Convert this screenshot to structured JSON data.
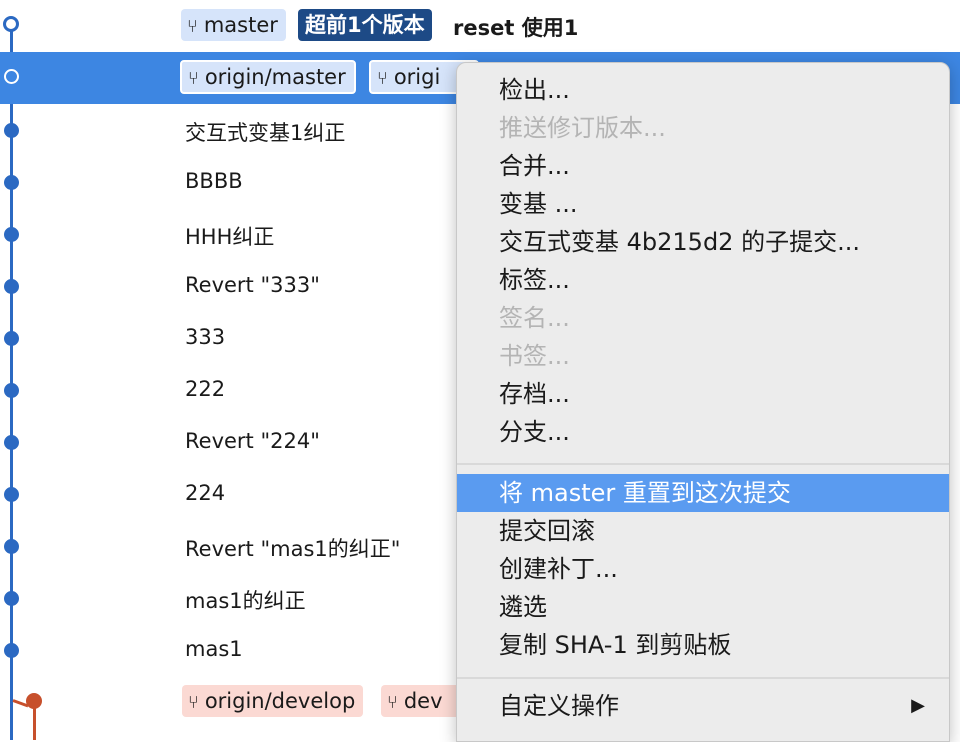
{
  "top_row": {
    "branch_label": "master",
    "ahead_badge": "超前1个版本",
    "commit_message": "reset 使用1"
  },
  "selected_row": {
    "tag1": "origin/master",
    "tag2": "origi"
  },
  "commits": [
    "交互式变基1纠正",
    "BBBB",
    "HHH纠正",
    "Revert \"333\"",
    "333",
    "222",
    "Revert \"224\"",
    "224",
    "Revert \"mas1的纠正\"",
    "mas1的纠正",
    "mas1"
  ],
  "bottom_row": {
    "tag1": "origin/develop",
    "tag2": "dev"
  },
  "branch_icon": "branch-icon",
  "context_menu": {
    "items": [
      {
        "label": "检出...",
        "enabled": true
      },
      {
        "label": "推送修订版本...",
        "enabled": false
      },
      {
        "label": "合并...",
        "enabled": true
      },
      {
        "label": "变基 ...",
        "enabled": true
      },
      {
        "label": "交互式变基 4b215d2 的子提交...",
        "enabled": true
      },
      {
        "label": "标签...",
        "enabled": true
      },
      {
        "label": "签名...",
        "enabled": false
      },
      {
        "label": "书签...",
        "enabled": false
      },
      {
        "label": "存档...",
        "enabled": true
      },
      {
        "label": "分支...",
        "enabled": true
      }
    ],
    "items2": [
      {
        "label": "将 master 重置到这次提交",
        "highlighted": true
      },
      {
        "label": "提交回滚"
      },
      {
        "label": "创建补丁..."
      },
      {
        "label": "遴选"
      },
      {
        "label": "复制 SHA-1 到剪贴板"
      }
    ],
    "custom_actions": "自定义操作",
    "submenu_arrow": "▶"
  },
  "colors": {
    "selection": "#3d86e2",
    "menu_highlight": "#5a9bf0",
    "graph_blue": "#2b69c2",
    "graph_red": "#c7502c"
  }
}
